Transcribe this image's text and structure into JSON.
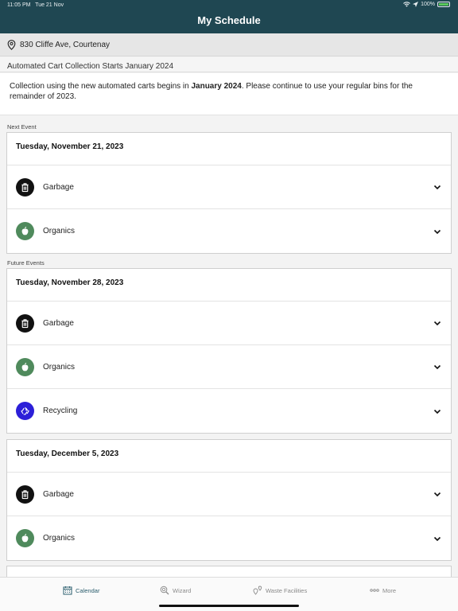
{
  "status_bar": {
    "time": "11:05 PM",
    "date": "Tue 21 Nov",
    "battery": "100%"
  },
  "header": {
    "title": "My Schedule"
  },
  "address": {
    "text": "830 Cliffe Ave, Courtenay",
    "icon": "map-pin-icon"
  },
  "notice": {
    "title": "Automated Cart Collection Starts January 2024",
    "body_before": "Collection using the new automated carts begins in ",
    "body_bold": "January 2024",
    "body_after": ". Please continue to use your regular bins for the remainder of 2023."
  },
  "next_event": {
    "label": "Next Event",
    "date": "Tuesday, November 21, 2023",
    "items": [
      {
        "label": "Garbage",
        "icon": "trash-icon",
        "color": "#111111"
      },
      {
        "label": "Organics",
        "icon": "apple-icon",
        "color": "#4f8a5c"
      }
    ]
  },
  "future_events": {
    "label": "Future Events",
    "events": [
      {
        "date": "Tuesday, November 28, 2023",
        "items": [
          {
            "label": "Garbage",
            "icon": "trash-icon",
            "color": "#111111"
          },
          {
            "label": "Organics",
            "icon": "apple-icon",
            "color": "#4f8a5c"
          },
          {
            "label": "Recycling",
            "icon": "recycle-icon",
            "color": "#2c1fd8"
          }
        ]
      },
      {
        "date": "Tuesday, December 5, 2023",
        "items": [
          {
            "label": "Garbage",
            "icon": "trash-icon",
            "color": "#111111"
          },
          {
            "label": "Organics",
            "icon": "apple-icon",
            "color": "#4f8a5c"
          }
        ]
      }
    ]
  },
  "tabs": [
    {
      "label": "Calendar",
      "icon": "calendar-icon",
      "active": true
    },
    {
      "label": "Wizard",
      "icon": "wizard-search-icon",
      "active": false
    },
    {
      "label": "Waste Facilities",
      "icon": "location-pins-icon",
      "active": false
    },
    {
      "label": "More",
      "icon": "more-dots-icon",
      "active": false
    }
  ],
  "colors": {
    "header_bg": "#1f4752",
    "active_tab": "#2b5d6d"
  }
}
